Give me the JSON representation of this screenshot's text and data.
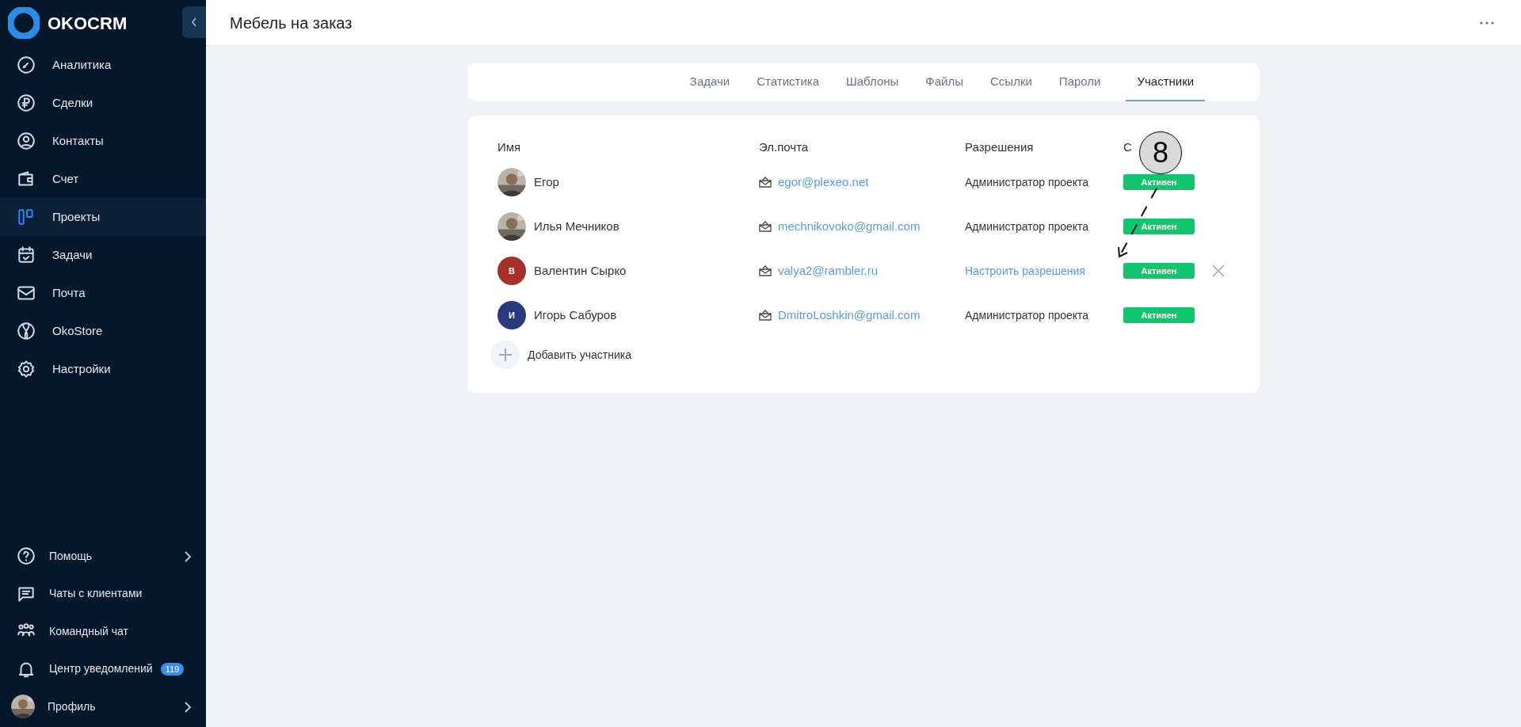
{
  "brand": "OKOCRM",
  "nav": [
    {
      "label": "Аналитика",
      "selected": false
    },
    {
      "label": "Сделки",
      "selected": false
    },
    {
      "label": "Контакты",
      "selected": false
    },
    {
      "label": "Счет",
      "selected": false
    },
    {
      "label": "Проекты",
      "selected": true
    },
    {
      "label": "Задачи",
      "selected": false
    },
    {
      "label": "Почта",
      "selected": false
    },
    {
      "label": "OkoStore",
      "selected": false
    },
    {
      "label": "Настройки",
      "selected": false
    }
  ],
  "nav_bottom": [
    {
      "label": "Помощь",
      "chevron": true
    },
    {
      "label": "Чаты с клиентами",
      "chevron": false
    },
    {
      "label": "Командный чат",
      "chevron": false
    },
    {
      "label": "Центр уведомлений",
      "chevron": false,
      "badge": "119"
    },
    {
      "label": "Профиль",
      "chevron": true
    }
  ],
  "page_title": "Мебель на заказ",
  "tabs": [
    {
      "label": "Задачи",
      "selected": false
    },
    {
      "label": "Статистика",
      "selected": false
    },
    {
      "label": "Шаблоны",
      "selected": false
    },
    {
      "label": "Файлы",
      "selected": false
    },
    {
      "label": "Ссылки",
      "selected": false
    },
    {
      "label": "Пароли",
      "selected": false
    },
    {
      "label": "Участники",
      "selected": true
    }
  ],
  "table": {
    "columns": [
      "Имя",
      "Эл.почта",
      "Разрешения",
      "С"
    ],
    "rows": [
      {
        "name": "Егор",
        "email": "egor@plexeo.net",
        "permission": "Администратор проекта",
        "permission_link": false,
        "status": "Активен",
        "removable": false
      },
      {
        "name": "Илья Мечников",
        "email": "mechnikovoko@gmail.com",
        "permission": "Администратор проекта",
        "permission_link": false,
        "status": "Активен",
        "removable": false
      },
      {
        "name": "Валентин Сырко",
        "avatar": {
          "kind": "initial",
          "initial": "В",
          "color": "#a8302a"
        },
        "email": "valya2@rambler.ru",
        "permission": "Настроить разрешения",
        "permission_link": true,
        "status": "Активен",
        "removable": true
      },
      {
        "name": "Игорь Сабуров",
        "avatar": {
          "kind": "initial",
          "initial": "И",
          "color": "#2b3a7a"
        },
        "email": "DmitroLoshkin@gmail.com",
        "permission": "Администратор проекта",
        "permission_link": false,
        "status": "Активен",
        "removable": false
      }
    ]
  },
  "add_member": "Добавить участника",
  "callout": "8"
}
